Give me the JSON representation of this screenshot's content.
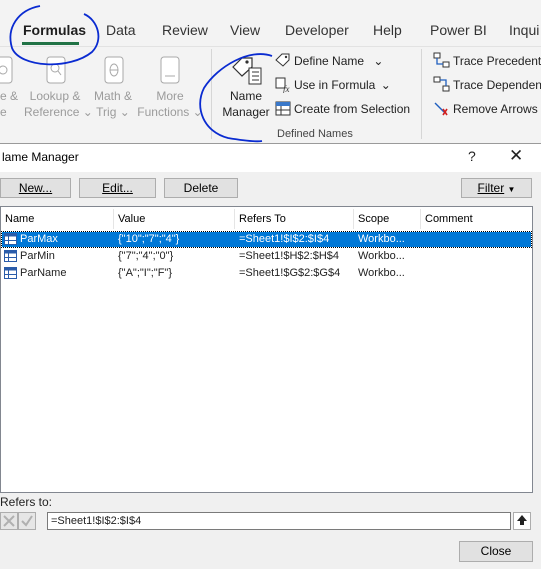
{
  "ribbon": {
    "tabs": [
      {
        "label": "Formulas",
        "active": true
      },
      {
        "label": "Data"
      },
      {
        "label": "Review"
      },
      {
        "label": "View"
      },
      {
        "label": "Developer"
      },
      {
        "label": "Help"
      },
      {
        "label": "Power BI"
      },
      {
        "label": "Inqui"
      }
    ],
    "groups": {
      "partial_left": {
        "line1": "e &",
        "line2": "e"
      },
      "lookup": {
        "line1": "Lookup &",
        "line2": "Reference"
      },
      "math": {
        "line1": "Math &",
        "line2": "Trig"
      },
      "more": {
        "line1": "More",
        "line2": "Functions"
      },
      "name_manager": {
        "line1": "Name",
        "line2": "Manager"
      },
      "define_name": "Define Name",
      "use_in_formula": "Use in Formula",
      "create_from_selection": "Create from Selection",
      "defined_names_label": "Defined Names",
      "trace_precedents": "Trace Precedents",
      "trace_dependents": "Trace Dependent",
      "remove_arrows": "Remove Arrows"
    },
    "accent_color": "#217346",
    "annotation_color": "#0a2bd1"
  },
  "dialog": {
    "title": "lame Manager",
    "help_glyph": "?",
    "close_glyph": "✕",
    "buttons": {
      "new": "New...",
      "edit": "Edit...",
      "delete": "Delete",
      "filter": "Filter"
    },
    "columns": [
      "Name",
      "Value",
      "Refers To",
      "Scope",
      "Comment"
    ],
    "rows": [
      {
        "name": "ParMax",
        "value": "{\"10\";\"7\";\"4\"}",
        "refers_to": "=Sheet1!$I$2:$I$4",
        "scope": "Workbo...",
        "comment": "",
        "selected": true
      },
      {
        "name": "ParMin",
        "value": "{\"7\";\"4\";\"0\"}",
        "refers_to": "=Sheet1!$H$2:$H$4",
        "scope": "Workbo...",
        "comment": "",
        "selected": false
      },
      {
        "name": "ParName",
        "value": "{\"A\";\"I\";\"F\"}",
        "refers_to": "=Sheet1!$G$2:$G$4",
        "scope": "Workbo...",
        "comment": "",
        "selected": false
      }
    ],
    "refers_to_label": "Refers to:",
    "refers_to_value": "=Sheet1!$I$2:$I$4",
    "close_button": "Close",
    "selection_color": "#0078d7"
  }
}
